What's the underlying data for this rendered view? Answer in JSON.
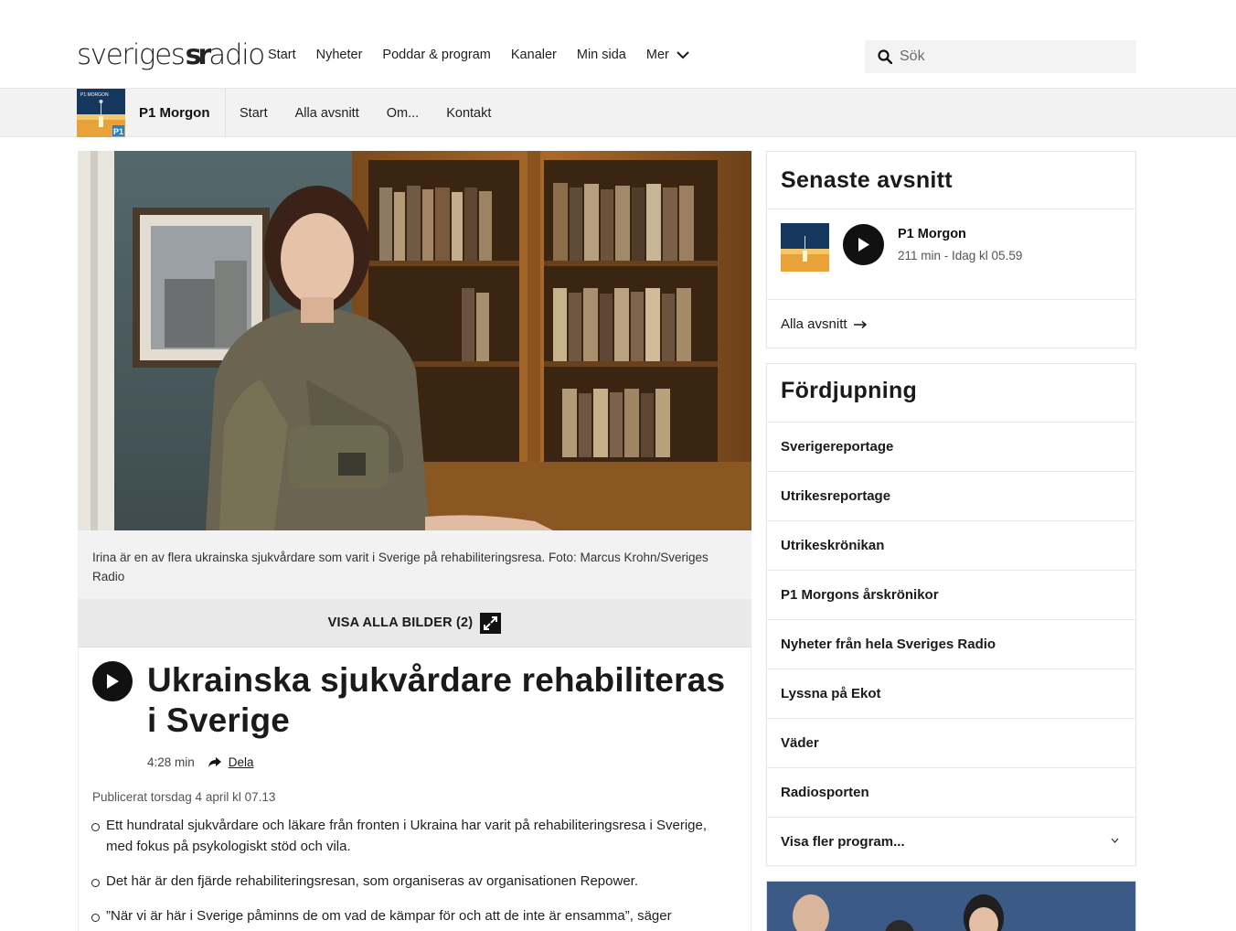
{
  "header": {
    "logo_left": "sveriges",
    "logo_mark": "sr",
    "logo_right": "adio",
    "nav": [
      {
        "label": "Start"
      },
      {
        "label": "Nyheter"
      },
      {
        "label": "Poddar & program"
      },
      {
        "label": "Kanaler"
      },
      {
        "label": "Min sida"
      },
      {
        "label": "Mer"
      }
    ],
    "search_placeholder": "Sök"
  },
  "program_bar": {
    "title": "P1 Morgon",
    "thumb_label": "P1 MORGON",
    "thumb_badge": "P1",
    "nav": [
      {
        "label": "Start"
      },
      {
        "label": "Alla avsnitt"
      },
      {
        "label": "Om..."
      },
      {
        "label": "Kontakt"
      }
    ]
  },
  "article": {
    "image_caption": "Irina är en av flera ukrainska sjukvårdare som varit i Sverige på rehabiliteringsresa. Foto: Marcus Krohn/Sveriges Radio",
    "show_all_images": "VISA ALLA BILDER (2)",
    "headline": "Ukrainska sjukvårdare rehabiliteras i Sverige",
    "duration": "4:28 min",
    "share_label": "Dela",
    "published": "Publicerat torsdag 4 april kl 07.13",
    "bullets": [
      {
        "text": "Ett hundratal sjukvårdare och läkare från fronten i Ukraina har varit på rehabiliteringsresa i Sverige, med fokus på psykologiskt stöd och vila."
      },
      {
        "text": "Det här är den fjärde rehabiliteringsresan, som organiseras av organisationen Repower."
      },
      {
        "text": "”När vi är här i Sverige påminns de om vad de kämpar för och att de inte är ensamma”, säger"
      }
    ]
  },
  "sidebar": {
    "latest": {
      "title": "Senaste avsnitt",
      "episode_name": "P1 Morgon",
      "episode_meta": "211 min  -  Idag kl 05.59",
      "all_episodes": "Alla avsnitt"
    },
    "deep_dive": {
      "title": "Fördjupning",
      "items": [
        {
          "label": "Sverigereportage"
        },
        {
          "label": "Utrikesreportage"
        },
        {
          "label": "Utrikeskrönikan"
        },
        {
          "label": "P1 Morgons årskrönikor"
        },
        {
          "label": "Nyheter från hela Sveriges Radio"
        },
        {
          "label": "Lyssna på Ekot"
        },
        {
          "label": "Väder"
        },
        {
          "label": "Radiosporten"
        },
        {
          "label": "Visa fler program..."
        }
      ]
    }
  },
  "colors": {
    "text": "#1a1a1a",
    "bar_bg": "#f2f2f2",
    "play_button": "#111111",
    "promo_bg": "#3c5a86"
  }
}
